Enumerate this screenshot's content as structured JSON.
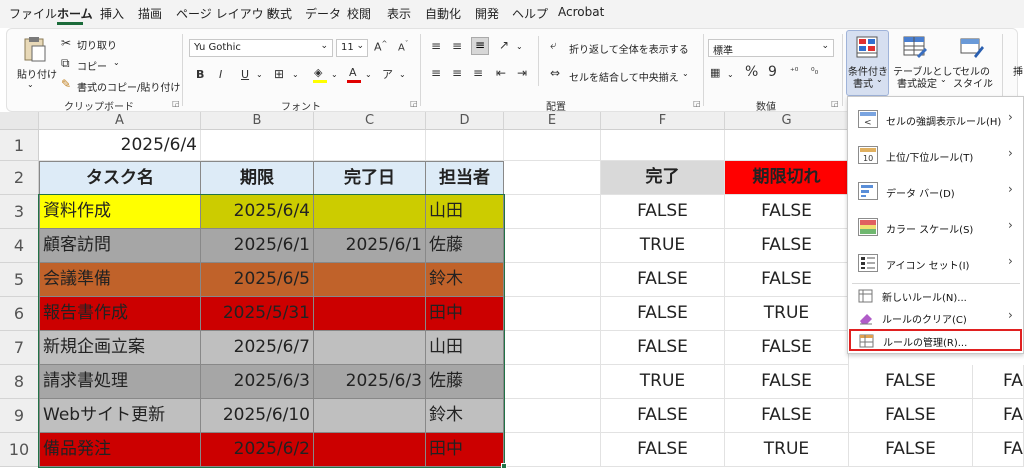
{
  "menu": {
    "tabs": [
      "ファイル",
      "ホーム",
      "挿入",
      "描画",
      "ページ レイアウト",
      "数式",
      "データ",
      "校閲",
      "表示",
      "自動化",
      "開発",
      "ヘルプ",
      "Acrobat"
    ],
    "active": "ホーム"
  },
  "ribbon": {
    "clipboard": {
      "paste": "貼り付け",
      "cut": "切り取り",
      "copy": "コピー",
      "format_painter": "書式のコピー/貼り付け",
      "group": "クリップボード"
    },
    "font": {
      "name": "Yu Gothic",
      "size": "11",
      "bold": "B",
      "italic": "I",
      "underline": "U",
      "group": "フォント"
    },
    "alignment": {
      "wrap": "折り返して全体を表示する",
      "merge": "セルを結合して中央揃え",
      "group": "配置"
    },
    "number": {
      "format": "標準",
      "percent": "%",
      "comma": "9",
      "group": "数値"
    },
    "styles": {
      "conditional": "条件付き",
      "conditional2": "書式",
      "table": "テーブルとして",
      "table2": "書式設定",
      "cell": "セルの",
      "cell2": "スタイル",
      "insert": "挿"
    }
  },
  "colors": {
    "yellow": "#ffff00",
    "olive": "#cccc00",
    "gray": "#a6a6a6",
    "lightgray": "#bfbfbf",
    "orange": "#c0622a",
    "red": "#cc0000",
    "header_blue": "#ddebf7",
    "status_gray": "#d9d9d9",
    "expired_red": "#ff0000",
    "highlight_box": "#e02020"
  },
  "sheet": {
    "columns": [
      "A",
      "B",
      "C",
      "D",
      "E",
      "F",
      "G"
    ],
    "rows": [
      "1",
      "2",
      "3",
      "4",
      "5",
      "6",
      "7",
      "8",
      "9",
      "10"
    ],
    "a1": "2025/6/4",
    "table_headers": [
      "タスク名",
      "期限",
      "完了日",
      "担当者"
    ],
    "tasks": [
      {
        "name": "資料作成",
        "due": "2025/6/4",
        "done": "",
        "owner": "山田"
      },
      {
        "name": "顧客訪問",
        "due": "2025/6/1",
        "done": "2025/6/1",
        "owner": "佐藤"
      },
      {
        "name": "会議準備",
        "due": "2025/6/5",
        "done": "",
        "owner": "鈴木"
      },
      {
        "name": "報告書作成",
        "due": "2025/5/31",
        "done": "",
        "owner": "田中"
      },
      {
        "name": "新規企画立案",
        "due": "2025/6/7",
        "done": "",
        "owner": "山田"
      },
      {
        "name": "請求書処理",
        "due": "2025/6/3",
        "done": "2025/6/3",
        "owner": "佐藤"
      },
      {
        "name": "Webサイト更新",
        "due": "2025/6/10",
        "done": "",
        "owner": "鈴木"
      },
      {
        "name": "備品発注",
        "due": "2025/6/2",
        "done": "",
        "owner": "田中"
      }
    ],
    "status_headers": [
      "完了",
      "期限切れ"
    ],
    "status_values": [
      [
        "FALSE",
        "FALSE"
      ],
      [
        "TRUE",
        "FALSE"
      ],
      [
        "FALSE",
        "FALSE"
      ],
      [
        "FALSE",
        "TRUE"
      ],
      [
        "FALSE",
        "FALSE"
      ],
      [
        "TRUE",
        "FALSE"
      ],
      [
        "FALSE",
        "FALSE"
      ],
      [
        "FALSE",
        "TRUE"
      ]
    ],
    "extra_col": [
      "FALSE",
      "FALSE",
      "FALSE"
    ],
    "extra_col2": [
      "FA",
      "FA",
      "FA"
    ]
  },
  "cf_menu": {
    "items": [
      {
        "label": "セルの強調表示ルール(H)",
        "arrow": "›"
      },
      {
        "label": "上位/下位ルール(T)",
        "arrow": "›"
      },
      {
        "label": "データ バー(D)",
        "arrow": "›"
      },
      {
        "label": "カラー スケール(S)",
        "arrow": "›"
      },
      {
        "label": "アイコン セット(I)",
        "arrow": "›"
      }
    ],
    "new_rule": "新しいルール(N)...",
    "clear_rule": "ルールのクリア(C)",
    "clear_arrow": "›",
    "manage_rule": "ルールの管理(R)..."
  }
}
